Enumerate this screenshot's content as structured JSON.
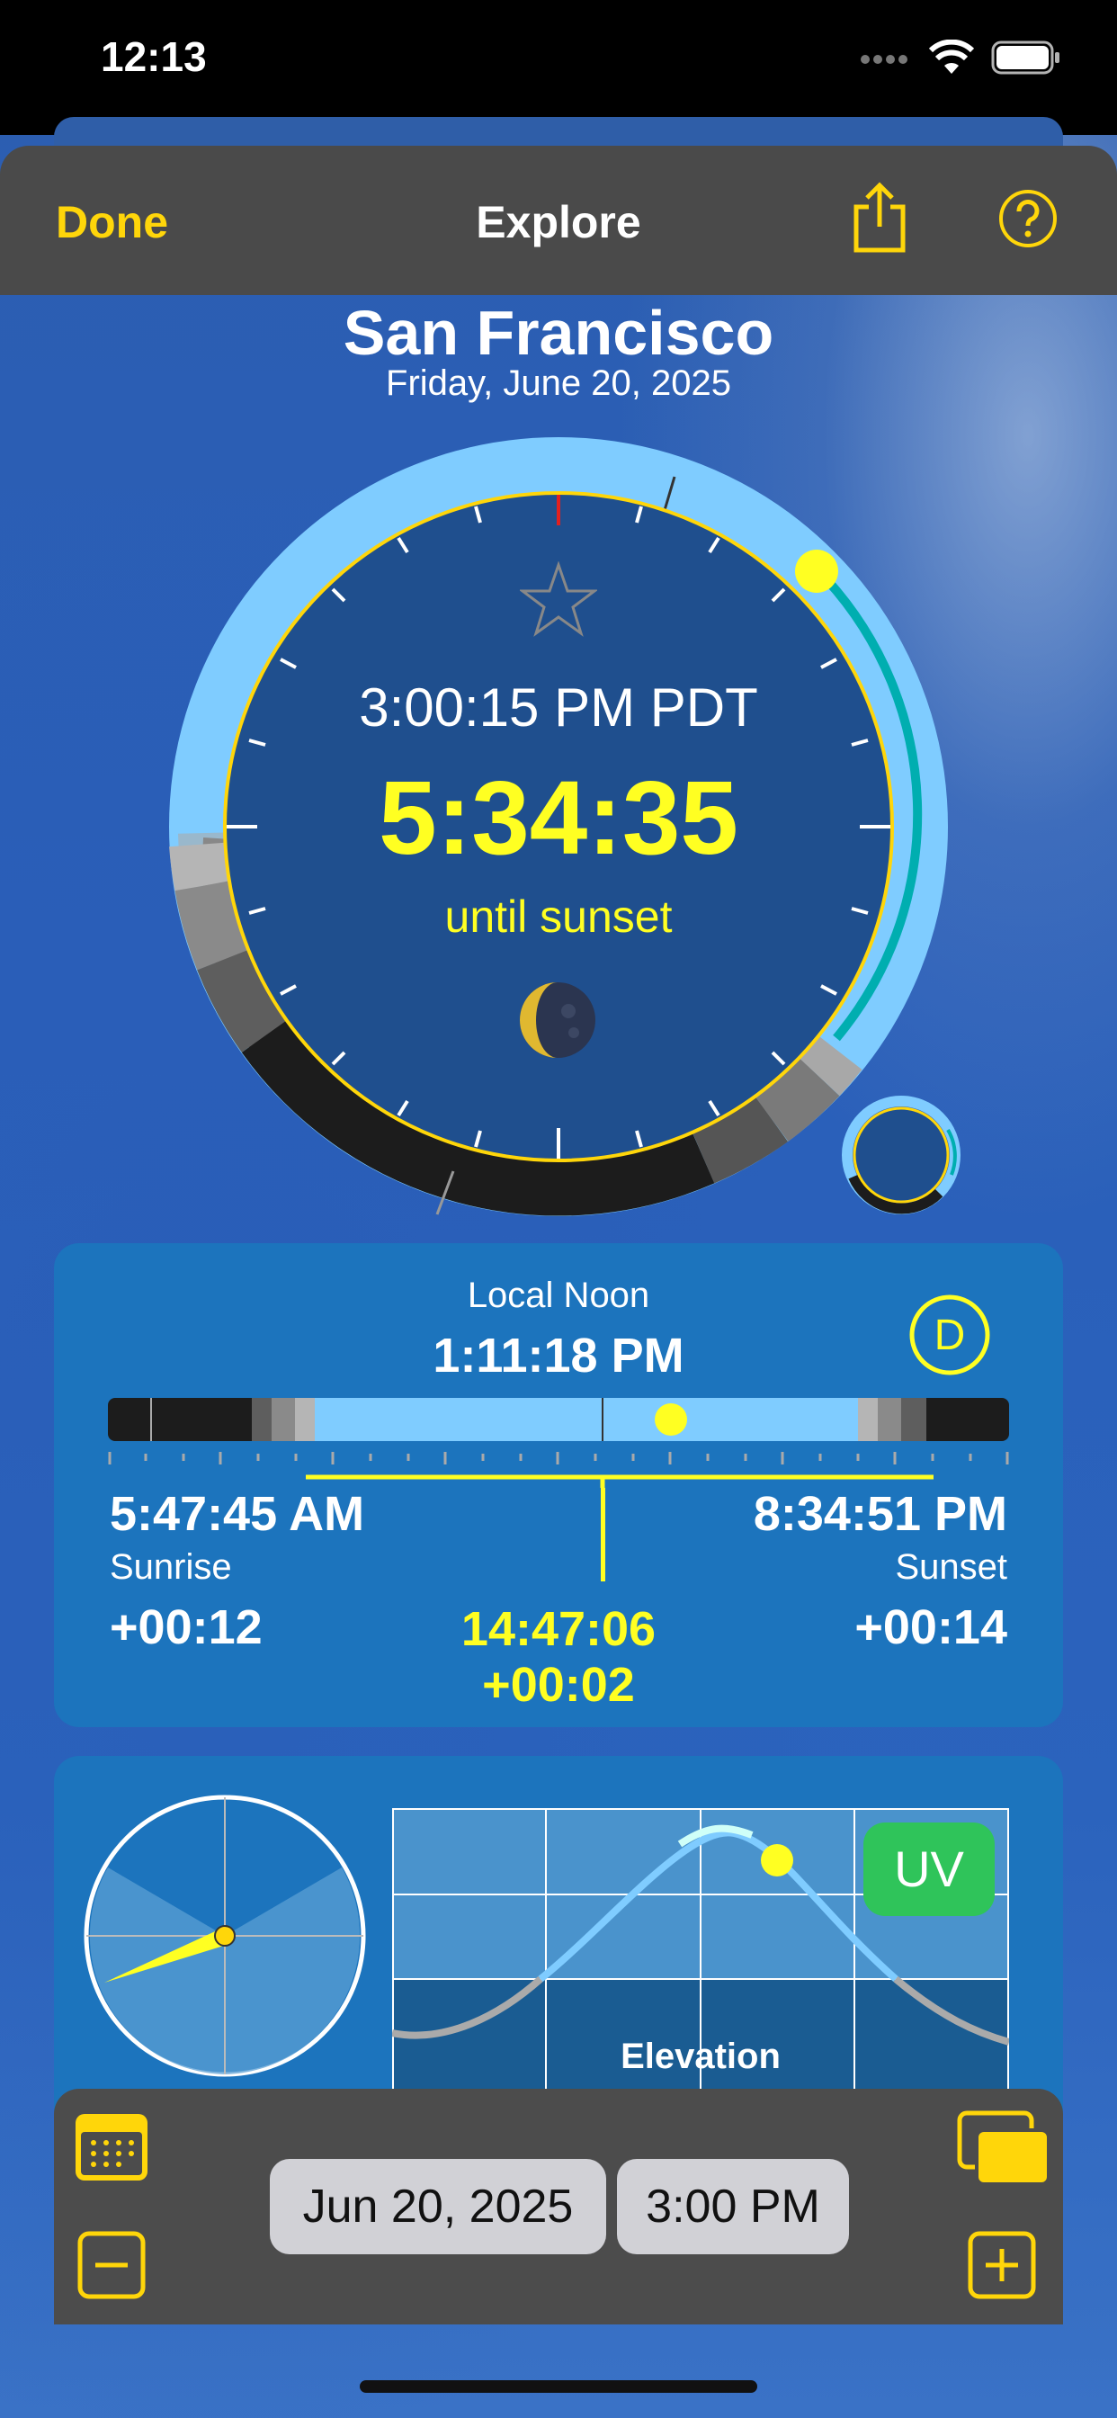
{
  "status_bar": {
    "time": "12:13"
  },
  "nav": {
    "done_label": "Done",
    "title": "Explore"
  },
  "header": {
    "city": "San Francisco",
    "date": "Friday, June 20, 2025"
  },
  "dial": {
    "clock_time": "3:00:15 PM PDT",
    "countdown": "5:34:35",
    "countdown_label": "until sunset"
  },
  "day_card": {
    "noon_label": "Local Noon",
    "noon_time": "1:11:18 PM",
    "badge": "D",
    "sunrise_time": "5:47:45 AM",
    "sunrise_label": "Sunrise",
    "sunrise_delta": "+00:12",
    "sunset_time": "8:34:51 PM",
    "sunset_label": "Sunset",
    "sunset_delta": "+00:14",
    "day_length": "14:47:06",
    "day_length_delta": "+00:02"
  },
  "elevation_card": {
    "uv_label": "UV",
    "graph_label": "Elevation"
  },
  "toolbar": {
    "date_value": "Jun 20, 2025",
    "time_value": "3:00 PM"
  },
  "colors": {
    "accent": "#ffd60a",
    "highlight": "#ffff22",
    "daylight": "#7fccff",
    "night": "#1c1c1c",
    "card": "#1c74bd",
    "bar": "#4a4a4a",
    "uv": "#2fc45a"
  }
}
